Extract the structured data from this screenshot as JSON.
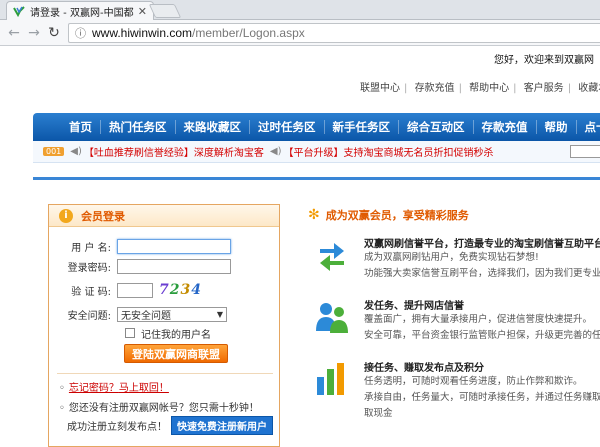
{
  "browser": {
    "tab_title": "请登录 - 双赢网-中国都",
    "url_host": "www.hiwinwin.com",
    "url_path": "/member/Logon.aspx"
  },
  "header": {
    "welcome": "您好，欢迎来到双赢网",
    "links": [
      "联盟中心",
      "存款充值",
      "帮助中心",
      "客户服务",
      "收藏本站"
    ]
  },
  "nav": {
    "items": [
      "首页",
      "热门任务区",
      "来路收藏区",
      "过时任务区",
      "新手任务区",
      "综合互动区",
      "存款充值",
      "帮助",
      "点卡代"
    ]
  },
  "notice": {
    "badge": "001",
    "items": [
      "【吐血推荐刷信誉经验】深度解析淘宝客",
      "【平台升级】支持淘宝商城无名员折扣促销秒杀"
    ]
  },
  "login": {
    "title": "会员登录",
    "username_label": "用 户 名:",
    "password_label": "登录密码:",
    "captcha_label": "验 证 码:",
    "captcha_chars": [
      "7",
      "2",
      "3",
      "4"
    ],
    "question_label": "安全问题:",
    "question_value": "无安全问题",
    "remember_label": "记住我的用户名",
    "submit": "登陆双赢网商联盟",
    "forgot_text": "忘记密码？",
    "forgot_link": "马上取回！"
  },
  "register": {
    "question": "您还没有注册双赢网帐号？您只需十秒钟！",
    "prompt": "成功注册立刻发布点！",
    "button": "快速免费注册新用户"
  },
  "services": {
    "title": "成为双赢会员，享受精彩服务",
    "items": [
      {
        "title": "双赢网刷信誉平台，打造最专业的淘宝刷信誉互助平台！",
        "lines": [
          "成为双赢网刷钻用户，免费实现钻石梦想!",
          "功能强大卖家信誉互刷平台，选择我们，因为我们更专业!"
        ]
      },
      {
        "title": "发任务、提升网店信誉",
        "lines": [
          "覆盖面广，拥有大量承接用户，促进信誉度快速提升。",
          "安全可靠，平台资金银行监管账户担保，升级更完善的任务担"
        ]
      },
      {
        "title": "接任务、赚取发布点及积分",
        "lines": [
          "任务透明，可随时观看任务进度，防止作弊和欺诈。",
          "承接自由，任务量大，可随时承接任务，并通过任务赚取发布",
          "取现金"
        ]
      }
    ]
  },
  "colors": {
    "nav_blue": "#0b56a8",
    "accent_orange": "#e05a00",
    "button_orange": "#f06a00"
  }
}
